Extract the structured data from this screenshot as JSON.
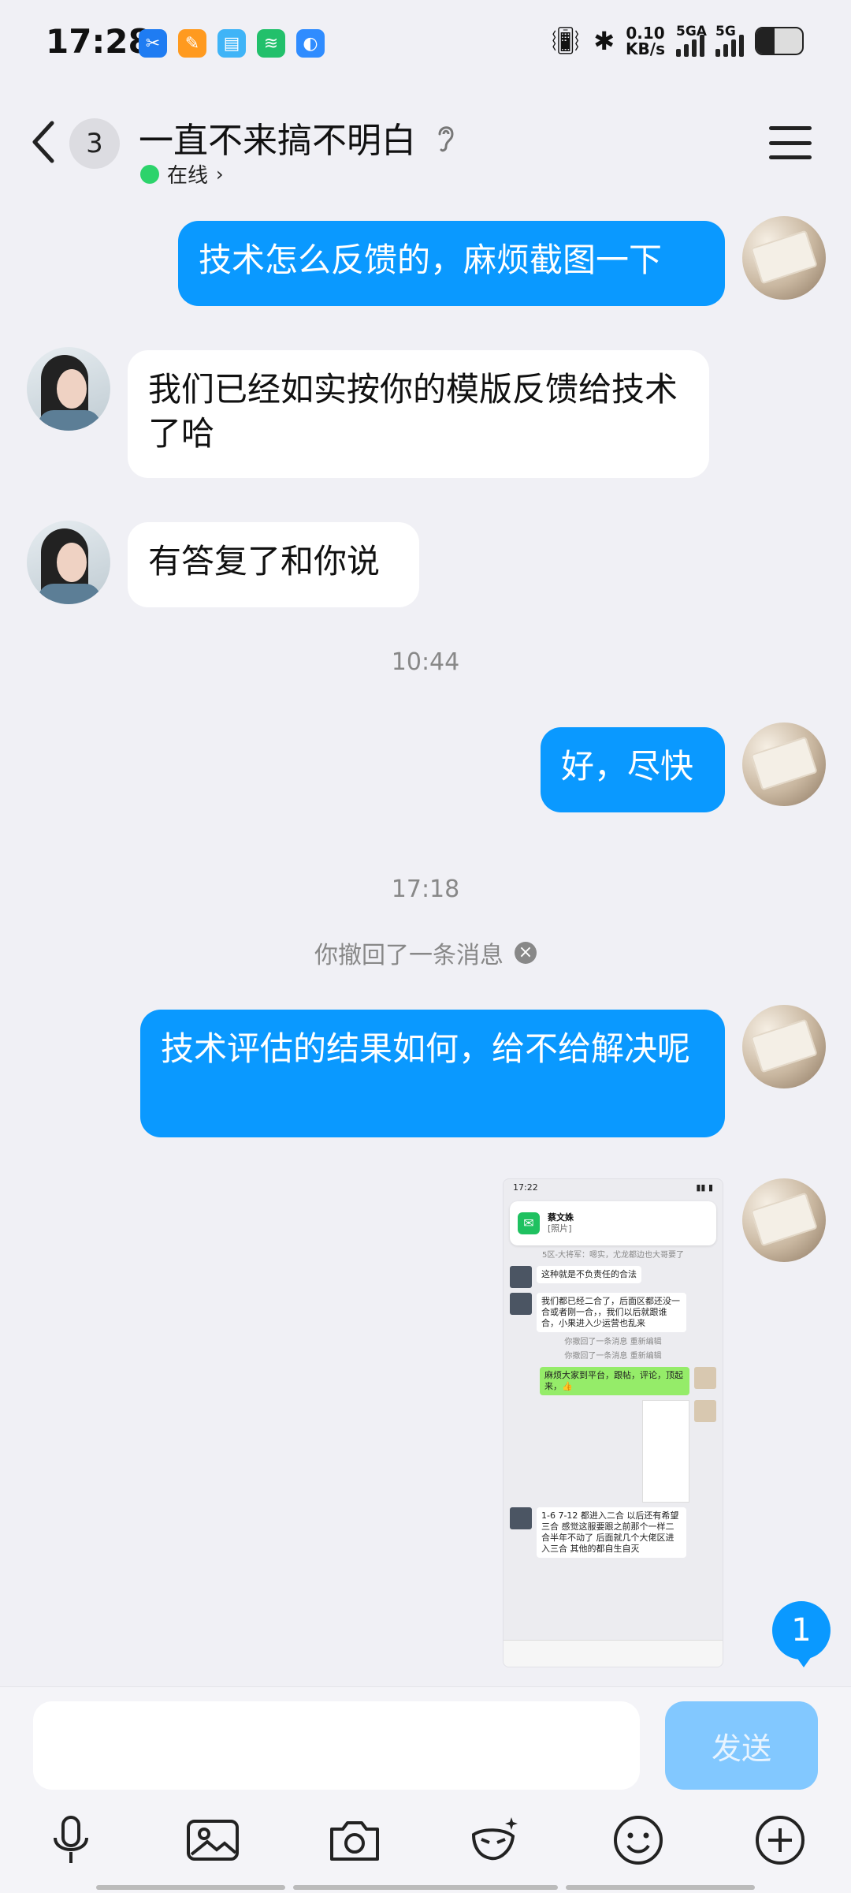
{
  "status_bar": {
    "time": "17:28",
    "network_speed_value": "0.10",
    "network_speed_unit": "KB/s",
    "signal1_label": "5GA",
    "signal2_label": "5G",
    "battery_level": 0.4
  },
  "header": {
    "unread_count": "3",
    "title": "一直不来搞不明白",
    "presence": "在线"
  },
  "messages": {
    "m1": "技术怎么反馈的，麻烦截图一下",
    "m2": "我们已经如实按你的模版反馈给技术了哈",
    "m3": "有答复了和你说",
    "t1": "10:44",
    "m4": "好，尽快",
    "t2": "17:18",
    "recall": "你撤回了一条消息",
    "m5": "技术评估的结果如何，给不给解决呢"
  },
  "screenshot": {
    "time": "17:22",
    "notif_name": "蔡文姝",
    "notif_text": "[照片]",
    "notice": "5区-大将军：嗯实，尤龙都边也大哥要了",
    "chat1": "这种就是不负责任的合法",
    "chat2": "我们都已经二合了，后面区都还没一合或者刚一合，，我们以后就跟谁合，小果进入少运营也乱来",
    "recall1": "你撤回了一条消息 重新编辑",
    "recall2": "你撤回了一条消息 重新编辑",
    "chat3": "麻烦大家到平台，跟帖，评论，顶起来，👍",
    "chat4": "1-6 7-12 都进入二合 以后还有希望三合 感觉这服要跟之前那个一样二合半年不动了 后面就几个大佬区进入三合 其他的都自生自灭"
  },
  "float_badge": "1",
  "composer": {
    "send_label": "发送"
  }
}
